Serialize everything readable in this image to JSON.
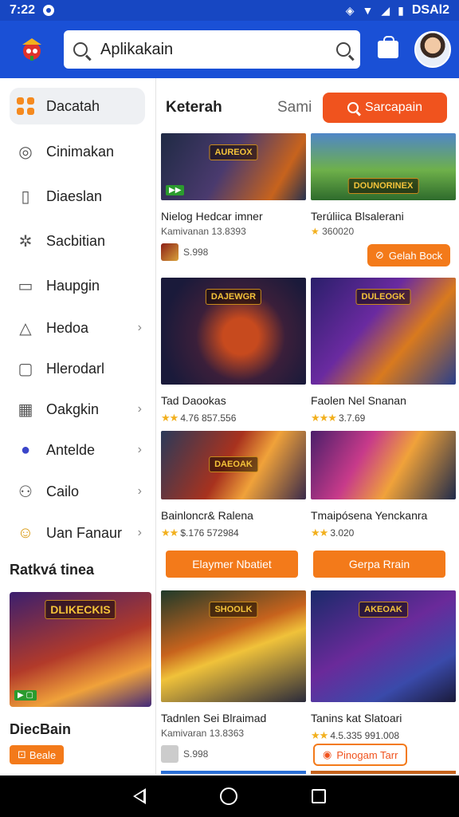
{
  "status_bar": {
    "time": "7:22",
    "right_text": "DSAl2"
  },
  "search": {
    "value": "Aplikakain"
  },
  "sidebar": {
    "items": [
      {
        "label": "Dacatah",
        "icon": "grid-icon",
        "chevron": false
      },
      {
        "label": "Cinimakan",
        "icon": "compass-icon",
        "chevron": false
      },
      {
        "label": "Diaeslan",
        "icon": "document-icon",
        "chevron": false
      },
      {
        "label": "Sacbitian",
        "icon": "puzzle-icon",
        "chevron": false
      },
      {
        "label": "Haupgin",
        "icon": "window-icon",
        "chevron": false
      },
      {
        "label": "Hedoa",
        "icon": "bell-icon",
        "chevron": true
      },
      {
        "label": "Hlerodarl",
        "icon": "chat-icon",
        "chevron": false
      },
      {
        "label": "Oakgkin",
        "icon": "calendar-icon",
        "chevron": true
      },
      {
        "label": "Antelde",
        "icon": "location-icon",
        "chevron": true
      },
      {
        "label": "Cailo",
        "icon": "users-icon",
        "chevron": true
      },
      {
        "label": "Uan Fanaur",
        "icon": "smile-icon",
        "chevron": true
      }
    ],
    "section_title": "Ratkvá tinea",
    "promo": {
      "logo": "DLIKECKIS",
      "title": "DiecBain",
      "badge": "Beale"
    }
  },
  "content": {
    "title": "Keterah",
    "sort_label": "Sami",
    "search_button": "Sarcapain",
    "cards": [
      {
        "name": "Nielog Hedcar imner",
        "sub": "Kamivanan 13.8393",
        "meta": "S.998",
        "logo": "AUREOX"
      },
      {
        "name": "Terúliica Blsalerani",
        "sub": "360020",
        "pill": "Gelah Bock",
        "logo": "DOUNORINEX"
      },
      {
        "name": "Tad Daookas",
        "rating": "4.76 857.556",
        "logo": "DAJEWGR"
      },
      {
        "name": "Faolen Nel Snanan",
        "rating": "3.7.69",
        "logo": "DULEOGK"
      },
      {
        "name": "Bainloncr& Ralena",
        "rating": "$.176 572984",
        "logo": "DAEOAK"
      },
      {
        "name": "Tmaipósena Yenckanra",
        "rating": "3.020",
        "logo": ""
      },
      {
        "name": "Tadnlen Sei Blraimad",
        "sub": "Kamivaran 13.8363",
        "meta": "S.998",
        "logo": "SHOOLK"
      },
      {
        "name": "Tanins kat Slatoari",
        "rating": "4.5.335 991.008",
        "pill": "Pinogam Tarr",
        "logo": "AKEOAK"
      }
    ],
    "button_left": "Elaymer Nbatiet",
    "button_right": "Gerpa Rrain"
  },
  "colors": {
    "primary": "#1a50d6",
    "accent": "#f0531e",
    "orange": "#f37a1a"
  }
}
